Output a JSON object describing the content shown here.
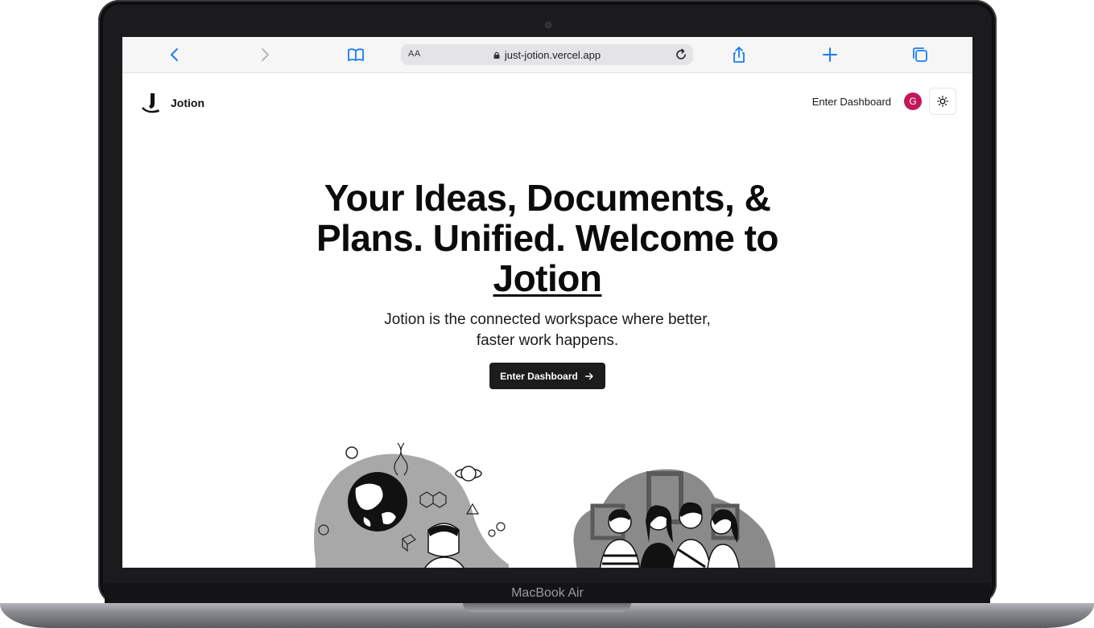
{
  "device": {
    "label": "MacBook Air"
  },
  "browser": {
    "aa_label": "AA",
    "url": "just-jotion.vercel.app"
  },
  "header": {
    "logo_text": "Jotion",
    "nav_link": "Enter Dashboard",
    "avatar_initial": "G"
  },
  "hero": {
    "title_part1": "Your Ideas, Documents, & Plans. Unified. Welcome to",
    "title_brand": " Jotion",
    "subtitle": "Jotion is the connected workspace where better, faster work happens.",
    "cta_label": "Enter Dashboard"
  },
  "colors": {
    "avatar_bg": "#c2185b",
    "cta_bg": "#1c1c1c",
    "safari_accent": "#1a7cf0"
  },
  "icons": [
    "back-icon",
    "forward-icon",
    "bookmarks-icon",
    "lock-icon",
    "reload-icon",
    "share-icon",
    "new-tab-icon",
    "tabs-icon",
    "sun-icon",
    "arrow-right-icon"
  ]
}
